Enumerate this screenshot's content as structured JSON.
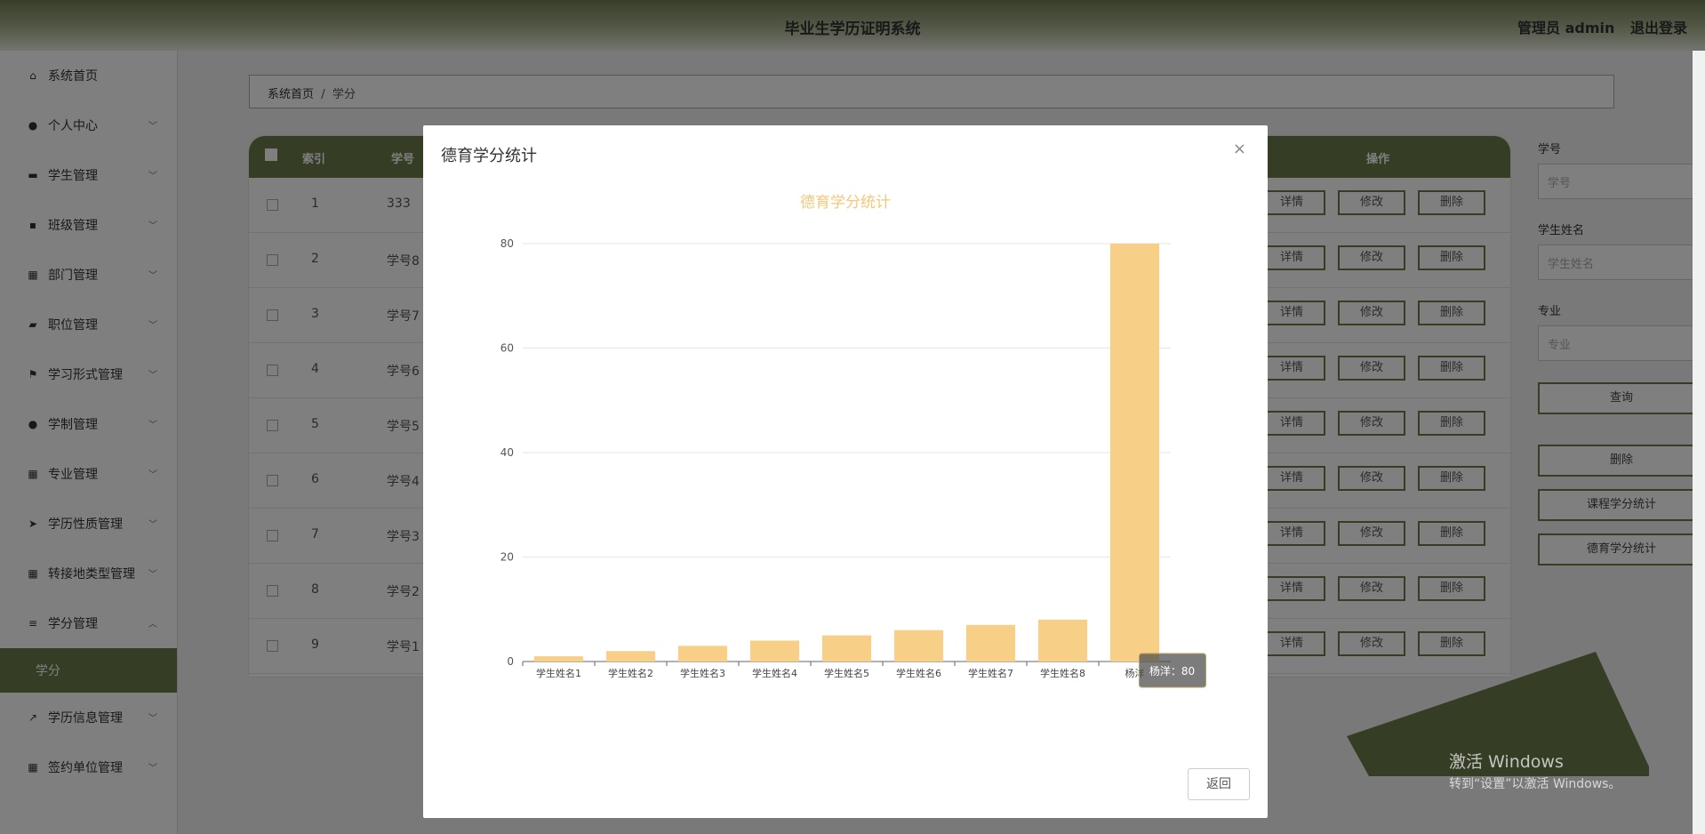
{
  "header": {
    "title": "毕业生学历证明系统",
    "user": "管理员 admin",
    "logout": "退出登录"
  },
  "sidebar": {
    "items": [
      {
        "label": "系统首页",
        "icon": "home-icon",
        "chev": false
      },
      {
        "label": "个人中心",
        "icon": "user-icon",
        "chev": true
      },
      {
        "label": "学生管理",
        "icon": "monitor-icon",
        "chev": true
      },
      {
        "label": "班级管理",
        "icon": "chat-icon",
        "chev": true
      },
      {
        "label": "部门管理",
        "icon": "grid-icon",
        "chev": true
      },
      {
        "label": "职位管理",
        "icon": "briefcase-icon",
        "chev": true
      },
      {
        "label": "学习形式管理",
        "icon": "flag-icon",
        "chev": true
      },
      {
        "label": "学制管理",
        "icon": "user-icon",
        "chev": true
      },
      {
        "label": "专业管理",
        "icon": "grid-icon",
        "chev": true
      },
      {
        "label": "学历性质管理",
        "icon": "send-icon",
        "chev": true
      },
      {
        "label": "转接地类型管理",
        "icon": "grid-icon",
        "chev": true
      },
      {
        "label": "学分管理",
        "icon": "list-icon",
        "chev": true,
        "open": true
      }
    ],
    "active_sub": "学分",
    "after": [
      {
        "label": "学历信息管理",
        "icon": "chart-icon"
      },
      {
        "label": "签约单位管理",
        "icon": "grid-icon"
      }
    ]
  },
  "breadcrumb": {
    "home": "系统首页",
    "sep": "/",
    "current": "学分"
  },
  "table": {
    "headers": {
      "index": "索引",
      "sid": "学号",
      "ops": "操作"
    },
    "rows": [
      {
        "idx": "1",
        "sid": "333"
      },
      {
        "idx": "2",
        "sid": "学号8"
      },
      {
        "idx": "3",
        "sid": "学号7"
      },
      {
        "idx": "4",
        "sid": "学号6"
      },
      {
        "idx": "5",
        "sid": "学号5"
      },
      {
        "idx": "6",
        "sid": "学号4"
      },
      {
        "idx": "7",
        "sid": "学号3"
      },
      {
        "idx": "8",
        "sid": "学号2"
      },
      {
        "idx": "9",
        "sid": "学号1"
      }
    ],
    "btn_detail": "详情",
    "btn_edit": "修改",
    "btn_delete": "删除"
  },
  "filters": {
    "sid_label": "学号",
    "sid_placeholder": "学号",
    "name_label": "学生姓名",
    "name_placeholder": "学生姓名",
    "major_label": "专业",
    "major_placeholder": "专业",
    "query": "查询",
    "delete": "删除",
    "course_stats": "课程学分统计",
    "moral_stats": "德育学分统计"
  },
  "watermark": {
    "line1": "激活 Windows",
    "line2": "转到“设置”以激活 Windows。"
  },
  "modal": {
    "title": "德育学分统计",
    "close": "×",
    "back": "返回"
  },
  "tooltip": "杨洋：80",
  "colors": {
    "accent": "#6b7a4a",
    "bar": "#f7cf86",
    "chart_title": "#f5c77a"
  },
  "chart_data": {
    "type": "bar",
    "title": "德育学分统计",
    "categories": [
      "学生姓名1",
      "学生姓名2",
      "学生姓名3",
      "学生姓名4",
      "学生姓名5",
      "学生姓名6",
      "学生姓名7",
      "学生姓名8",
      "杨洋"
    ],
    "values": [
      1,
      2,
      3,
      4,
      5,
      6,
      7,
      8,
      80
    ],
    "ylim": [
      0,
      80
    ],
    "yticks": [
      0,
      20,
      40,
      60,
      80
    ],
    "grid": true
  }
}
